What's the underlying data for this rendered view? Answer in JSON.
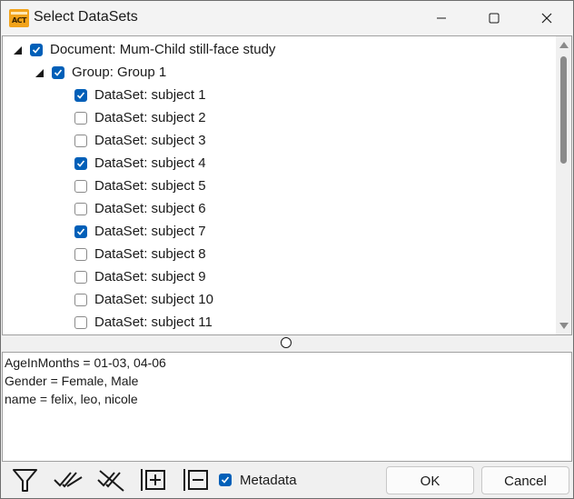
{
  "window": {
    "title": "Select DataSets",
    "icon": "app-logo-icon",
    "icon_text": "ACT"
  },
  "tree": {
    "document": {
      "label": "Document: Mum-Child still-face study",
      "checked": true,
      "expanded": true
    },
    "group": {
      "label": "Group: Group 1",
      "checked": true,
      "expanded": true
    },
    "datasets": [
      {
        "label": "DataSet: subject 1",
        "checked": true
      },
      {
        "label": "DataSet: subject 2",
        "checked": false
      },
      {
        "label": "DataSet: subject 3",
        "checked": false
      },
      {
        "label": "DataSet: subject 4",
        "checked": true
      },
      {
        "label": "DataSet: subject 5",
        "checked": false
      },
      {
        "label": "DataSet: subject 6",
        "checked": false
      },
      {
        "label": "DataSet: subject 7",
        "checked": true
      },
      {
        "label": "DataSet: subject 8",
        "checked": false
      },
      {
        "label": "DataSet: subject 9",
        "checked": false
      },
      {
        "label": "DataSet: subject 10",
        "checked": false
      },
      {
        "label": "DataSet: subject 11",
        "checked": false
      }
    ]
  },
  "metadata_lines": [
    "AgeInMonths = 01-03, 04-06",
    "Gender = Female, Male",
    "name = felix, leo, nicole"
  ],
  "toolbar": {
    "icons": [
      "filter-icon",
      "check-all-icon",
      "uncheck-all-icon",
      "expand-all-icon",
      "collapse-all-icon"
    ],
    "metadata_label": "Metadata",
    "metadata_checked": true
  },
  "buttons": {
    "ok": "OK",
    "cancel": "Cancel"
  },
  "colors": {
    "accent": "#005fb8",
    "titlebar": "#f3f3f3",
    "background": "#f0f0f0",
    "icon": "#f2a31a"
  }
}
